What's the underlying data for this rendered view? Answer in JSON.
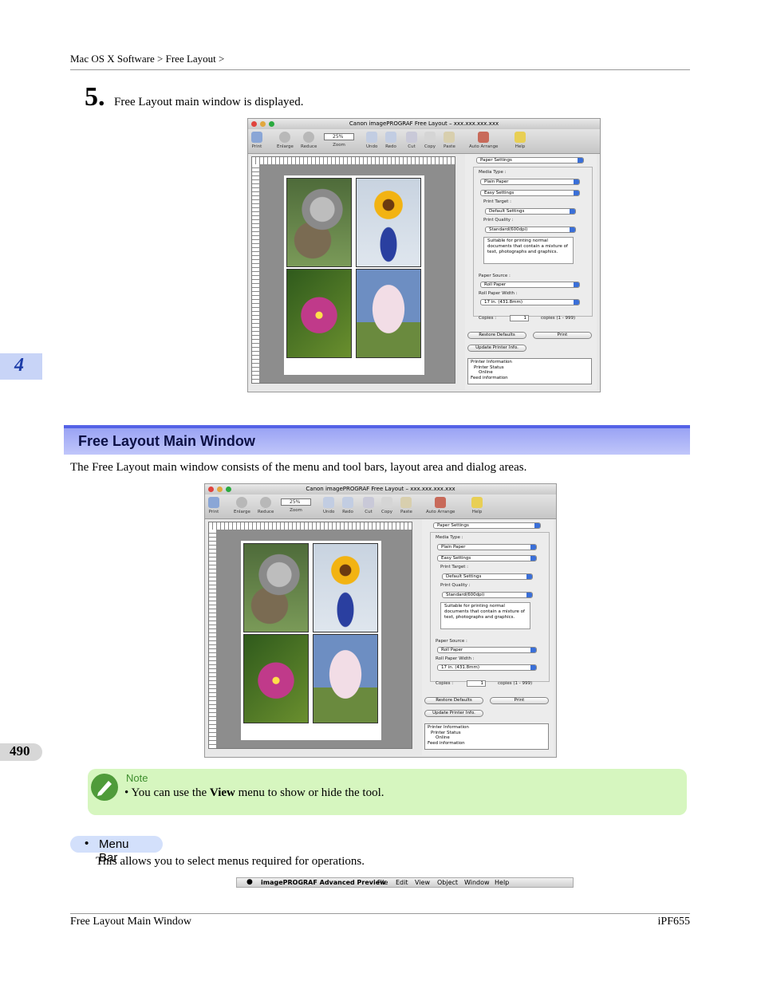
{
  "header": {
    "breadcrumb": "Mac OS X Software > Free Layout >"
  },
  "step": {
    "number": "5.",
    "text": "Free Layout main window is displayed."
  },
  "chapter_tab": "4",
  "page_number": "490",
  "section": {
    "title": "Free Layout Main Window",
    "intro": "The Free Layout main window consists of the menu and tool bars, layout area and dialog areas."
  },
  "screenshot": {
    "window_title": "Canon imagePROGRAF Free Layout – xxx.xxx.xxx.xxx",
    "toolbar": {
      "print": "Print",
      "enlarge": "Enlarge",
      "reduce": "Reduce",
      "zoom_value": "25%",
      "zoom": "Zoom",
      "undo": "Undo",
      "redo": "Redo",
      "cut": "Cut",
      "copy": "Copy",
      "paste": "Paste",
      "auto_arrange": "Auto Arrange",
      "help": "Help"
    },
    "dialog": {
      "panel_select": "Paper Settings",
      "media_type_label": "Media Type :",
      "media_type": "Plain Paper",
      "mode_select": "Easy Settings",
      "print_target_label": "Print Target :",
      "print_target": "Default Settings",
      "print_quality_label": "Print Quality :",
      "print_quality": "Standard(600dpi)",
      "description": "Suitable for printing normal documents that contain a mixture of text, photographs and graphics.",
      "paper_source_label": "Paper Source :",
      "paper_source": "Roll Paper",
      "roll_width_label": "Roll Paper Width :",
      "roll_width": "17 in. (431.8mm)",
      "copies_label": "Copies :",
      "copies_value": "1",
      "copies_range": "copies (1 - 999)",
      "restore_defaults": "Restore Defaults",
      "print_button": "Print",
      "update_printer_info": "Update Printer Info.",
      "info_lines": [
        "Printer Information",
        "Printer Status",
        "Online",
        "Feed information"
      ]
    }
  },
  "note": {
    "title": "Note",
    "text_before": "You can use the ",
    "text_bold": "View",
    "text_after": " menu to show or hide the tool."
  },
  "menu_bar_section": {
    "bullet": "Menu Bar",
    "text": "This allows you to select menus required for operations.",
    "menubar": {
      "app": "imagePROGRAF Advanced Preview",
      "items": [
        "File",
        "Edit",
        "View",
        "Object",
        "Window",
        "Help"
      ]
    }
  },
  "footer": {
    "left": "Free Layout Main Window",
    "right": "iPF655"
  },
  "colors": {
    "section_bar": "#9aa3f4",
    "note_bg": "#d6f6bf",
    "chapter_tab": "#c8d4f7",
    "accent_blue": "#1c3ca8"
  }
}
